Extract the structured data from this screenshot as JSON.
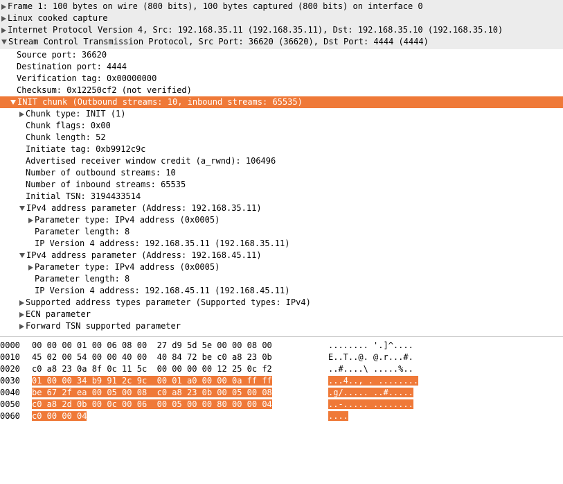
{
  "top": {
    "frame": "Frame 1: 100 bytes on wire (800 bits), 100 bytes captured (800 bits) on interface 0",
    "linux": "Linux cooked capture",
    "ip": "Internet Protocol Version 4, Src: 192.168.35.11 (192.168.35.11), Dst: 192.168.35.10 (192.168.35.10)",
    "sctp": "Stream Control Transmission Protocol, Src Port: 36620 (36620), Dst Port: 4444 (4444)"
  },
  "sctp_fields": {
    "src_port": "Source port: 36620",
    "dst_port": "Destination port: 4444",
    "ver_tag": "Verification tag: 0x00000000",
    "checksum": "Checksum: 0x12250cf2 (not verified)"
  },
  "init_header": "INIT chunk (Outbound streams: 10, inbound streams: 65535)",
  "init": {
    "chunk_type": "Chunk type: INIT (1)",
    "chunk_flags": "Chunk flags: 0x00",
    "chunk_length": "Chunk length: 52",
    "init_tag": "Initiate tag: 0xb9912c9c",
    "a_rwnd": "Advertised receiver window credit (a_rwnd): 106496",
    "out_streams": "Number of outbound streams: 10",
    "in_streams": "Number of inbound streams: 65535",
    "initial_tsn": "Initial TSN: 3194433514"
  },
  "ipv4_1": {
    "header": "IPv4 address parameter (Address: 192.168.35.11)",
    "ptype": "Parameter type: IPv4 address (0x0005)",
    "plen": "Parameter length: 8",
    "paddr": "IP Version 4 address: 192.168.35.11 (192.168.35.11)"
  },
  "ipv4_2": {
    "header": "IPv4 address parameter (Address: 192.168.45.11)",
    "ptype": "Parameter type: IPv4 address (0x0005)",
    "plen": "Parameter length: 8",
    "paddr": "IP Version 4 address: 192.168.45.11 (192.168.45.11)"
  },
  "sup_addr": "Supported address types parameter (Supported types: IPv4)",
  "ecn": "ECN parameter",
  "fwd_tsn": "Forward TSN supported parameter",
  "hex": {
    "off": [
      "0000",
      "0010",
      "0020",
      "0030",
      "0040",
      "0050",
      "0060"
    ],
    "r0b": "00 00 00 01 00 06 08 00  27 d9 5d 5e 00 00 08 00",
    "r0a": "........ '.]^....",
    "r1b": "45 02 00 54 00 00 40 00  40 84 72 be c0 a8 23 0b",
    "r1a": "E..T..@. @.r...#.",
    "r2b": "c0 a8 23 0a 8f 0c 11 5c  00 00 00 00 12 25 0c f2",
    "r2a": "..#....\\ .....%..",
    "r3b": "01 00 00 34 b9 91 2c 9c  00 01 a0 00 00 0a ff ff",
    "r3a": "...4.., . ........",
    "r4b": "be 67 2f ea 00 05 00 08  c0 a8 23 0b 00 05 00 08",
    "r4a": ".g/..... ..#.....",
    "r5b": "c0 a8 2d 0b 00 0c 00 06  00 05 00 00 80 00 00 04",
    "r5a": "..-..... ........",
    "r6b": "c0 00 00 04",
    "r6a": "...."
  }
}
